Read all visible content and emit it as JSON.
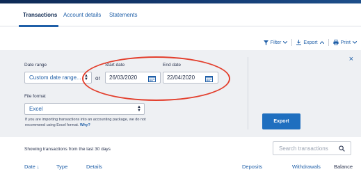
{
  "tabs": [
    {
      "label": "Transactions"
    },
    {
      "label": "Account details"
    },
    {
      "label": "Statements"
    }
  ],
  "toolbar": {
    "filter_label": "Filter",
    "export_label": "Export",
    "print_label": "Print"
  },
  "panel": {
    "close_glyph": "×",
    "date_range_label": "Date range",
    "date_range_value": "Custom date range...",
    "or_text": "or",
    "start_date_label": "Start date",
    "start_date_value": "26/03/2020",
    "end_date_label": "End date",
    "end_date_value": "22/04/2020",
    "file_format_label": "File format",
    "file_format_value": "Excel",
    "note_text": "If you are importing transactions into an accounting package, we do not recommend using Excel format.",
    "note_link": "Why?",
    "export_button": "Export"
  },
  "list": {
    "showing_text": "Showing transactions from the last 30 days",
    "search_placeholder": "Search transactions",
    "columns": [
      "Date ↓",
      "Type",
      "Details",
      "Deposits",
      "Withdrawals",
      "Balance"
    ]
  },
  "colors": {
    "accent": "#1f5fa8",
    "panel_bg": "#eef0f3",
    "highlight": "#e3402e",
    "button": "#1f6fbf"
  },
  "icons": {
    "filter": "funnel-icon",
    "export": "download-icon",
    "print": "printer-icon",
    "calendar": "calendar-icon",
    "search": "magnifier-icon",
    "close": "close-icon"
  }
}
